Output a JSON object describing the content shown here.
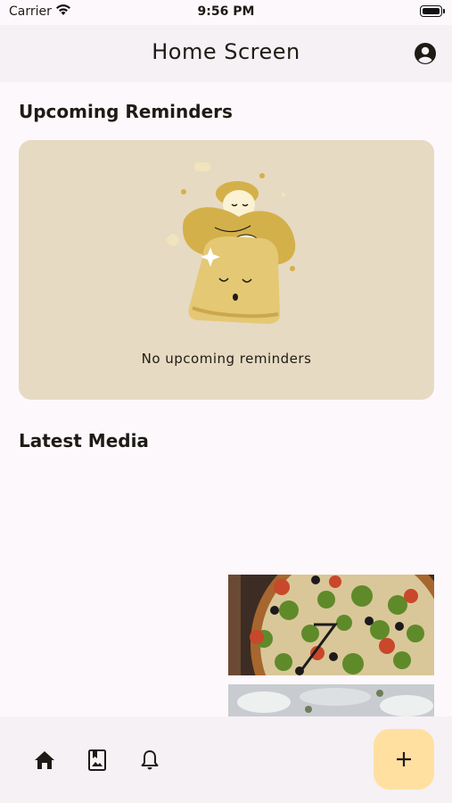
{
  "status_bar": {
    "carrier": "Carrier",
    "time": "9:56 PM"
  },
  "app_bar": {
    "title": "Home Screen",
    "account_icon": "account-circle-icon"
  },
  "reminders": {
    "title": "Upcoming Reminders",
    "empty_message": "No upcoming reminders",
    "illustration": "sleeping-bell-illustration"
  },
  "media": {
    "title": "Latest Media",
    "items": [
      {
        "icon": "pizza-photo"
      },
      {
        "icon": "partial-photo"
      }
    ]
  },
  "bottom_nav": {
    "items": [
      {
        "icon": "home-icon",
        "selected": true
      },
      {
        "icon": "photo-album-icon"
      },
      {
        "icon": "bell-icon"
      }
    ],
    "fab_icon": "plus-icon"
  },
  "colors": {
    "background": "#fdf8fb",
    "card": "#e6dac2",
    "fab": "#ffe0a0",
    "illustration_accent": "#d4b04a"
  }
}
